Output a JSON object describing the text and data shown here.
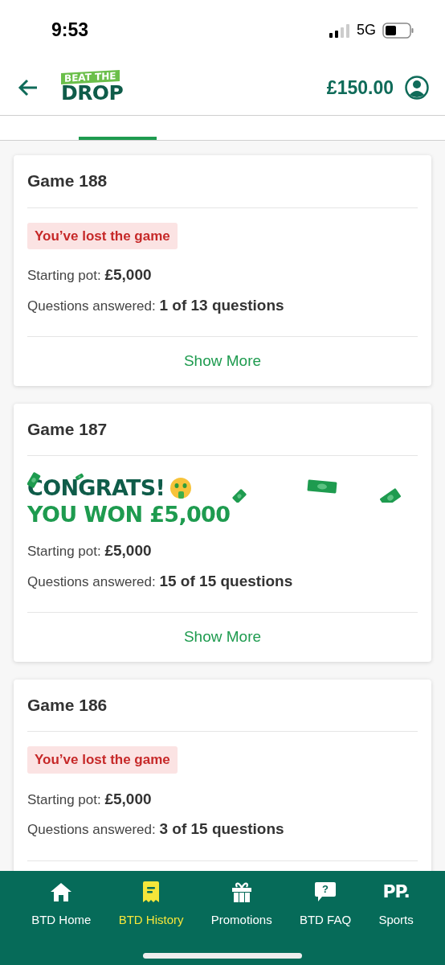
{
  "status_bar": {
    "time": "9:53",
    "network": "5G"
  },
  "header": {
    "logo_top": "BEAT THE",
    "logo_bottom": "DROP",
    "balance": "£150.00"
  },
  "games": [
    {
      "kind": "lost",
      "title": "Game 188",
      "badge": "You’ve lost the game",
      "pot_label": "Starting pot:",
      "pot": "£5,000",
      "answered_label": "Questions answered:",
      "answered": "1 of 13 questions",
      "button": "Show More"
    },
    {
      "kind": "won",
      "title": "Game 187",
      "congrats": "CONGRATS!",
      "won": "YOU WON £5,000",
      "pot_label": "Starting pot:",
      "pot": "£5,000",
      "answered_label": "Questions answered:",
      "answered": "15 of 15 questions",
      "button": "Show More"
    },
    {
      "kind": "lost",
      "title": "Game 186",
      "badge": "You’ve lost the game",
      "pot_label": "Starting pot:",
      "pot": "£5,000",
      "answered_label": "Questions answered:",
      "answered": "3 of 15 questions"
    }
  ],
  "nav": [
    {
      "kind": "home",
      "label": "BTD Home",
      "selected": false
    },
    {
      "kind": "history",
      "label": "BTD History",
      "selected": true
    },
    {
      "kind": "gift",
      "label": "Promotions",
      "selected": false
    },
    {
      "kind": "faq",
      "icon_text": "?",
      "label": "BTD FAQ",
      "selected": false
    },
    {
      "kind": "text",
      "icon_text": "PP.",
      "label": "Sports",
      "selected": false
    }
  ]
}
